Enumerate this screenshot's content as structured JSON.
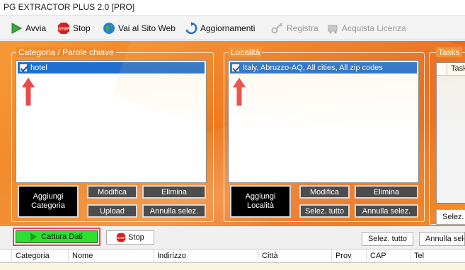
{
  "window": {
    "title": "PG EXTRACTOR PLUS 2.0 [PRO]"
  },
  "toolbar": {
    "avvia": {
      "label": "Avvia",
      "icon": "play-icon"
    },
    "stop": {
      "label": "Stop",
      "icon": "stop-sign-icon"
    },
    "sito": {
      "label": "Vai al Sito Web",
      "icon": "globe-icon"
    },
    "aggiornamenti": {
      "label": "Aggiornamenti",
      "icon": "refresh-icon"
    },
    "registra": {
      "label": "Registra",
      "icon": "key-icon",
      "disabled": true
    },
    "licenza": {
      "label": "Acquista Licenza",
      "icon": "cart-icon",
      "disabled": true
    }
  },
  "categoria": {
    "title": "Categoria / Parole chiave",
    "items": [
      {
        "label": "hotel",
        "checked": true
      }
    ],
    "buttons": {
      "aggiungi": "Aggiungi Categoria",
      "modifica": "Modifica",
      "elimina": "Elimina",
      "upload": "Upload",
      "annulla": "Annulla selez."
    }
  },
  "localita": {
    "title": "Località",
    "items": [
      {
        "label": "Italy, Abruzzo-AQ, All cities, All zip codes",
        "checked": true
      }
    ],
    "buttons": {
      "aggiungi": "Aggiungi Località",
      "modifica": "Modifica",
      "elimina": "Elimina",
      "selez_tutto": "Selez. tutto",
      "annulla": "Annulla selez."
    }
  },
  "tasks": {
    "title": "Tasks",
    "column": "Task",
    "button": "Selez."
  },
  "bottom": {
    "cattura": "Cattura Dati",
    "stop": "Stop",
    "selez_tutto": "Selez. tutto",
    "annulla": "Annulla sele"
  },
  "grid": {
    "columns": [
      "Categoria",
      "Nome",
      "Indirizzo",
      "Città",
      "Prov",
      "CAP",
      "Tel"
    ]
  },
  "colors": {
    "accent_orange": "#f07f22",
    "selection_blue": "#1e6fd0",
    "cattura_green": "#2ee02e",
    "highlight_red": "#e84b4b"
  }
}
